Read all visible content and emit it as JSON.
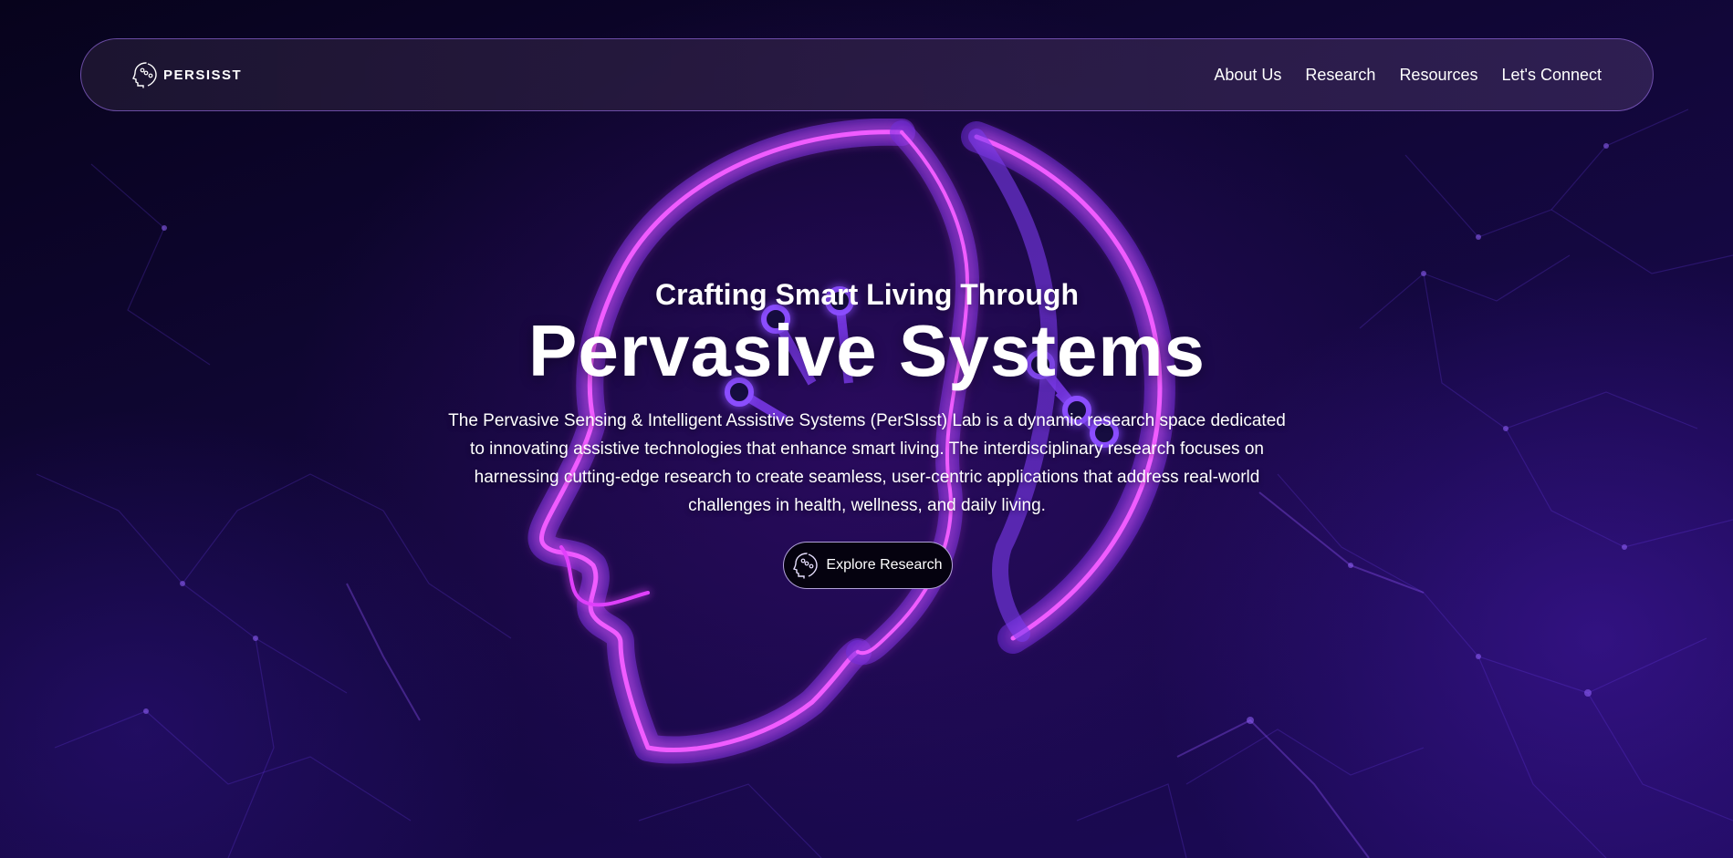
{
  "nav": {
    "brand_name": "PERSISST",
    "brand_icon": "head-circuit-icon",
    "links": [
      {
        "label": "About Us"
      },
      {
        "label": "Research"
      },
      {
        "label": "Resources"
      },
      {
        "label": "Let's Connect"
      }
    ]
  },
  "hero": {
    "subtitle": "Crafting Smart Living Through",
    "title": "Pervasive Systems",
    "description": "The Pervasive Sensing & Intelligent Assistive Systems (PerSIsst) Lab is a dynamic research space dedicated to innovating assistive technologies that enhance smart living. The interdisciplinary research focuses on harnessing cutting-edge research to create seamless, user-centric applications that address real-world challenges in health, wellness, and daily living.",
    "cta_label": "Explore Research",
    "cta_icon": "head-circuit-icon",
    "art_icon": "neon-head-profile-icon"
  },
  "colors": {
    "background": "#0d0630",
    "neon_pink": "#e040fb",
    "neon_purple": "#7c3aed",
    "nav_border": "#aa78ff"
  }
}
